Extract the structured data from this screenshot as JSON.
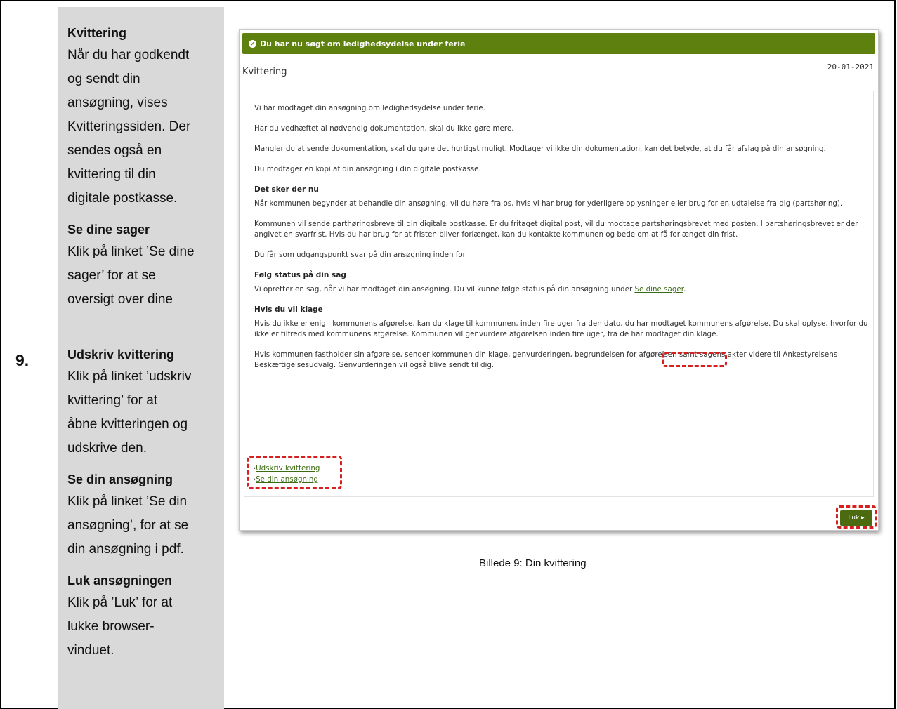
{
  "step": {
    "number": "9."
  },
  "sidebar": {
    "receipt": {
      "heading": "Kvittering",
      "text": "Når du har godkendt\nog sendt din\nansøgning, vises\nKvitteringssiden. Der\nsendes også en\nkvittering til din\ndigitale postkasse."
    },
    "cases": {
      "heading": "Se dine sager",
      "text": "Klik på linket ’Se dine\nsager’ for at se\noversigt over dine"
    },
    "print": {
      "heading": "Udskriv kvittering",
      "text": "Klik på linket ’udskriv\nkvittering’ for at\nåbne kvitteringen og\nudskrive den."
    },
    "application": {
      "heading": "Se din ansøgning",
      "text": "Klik på linket ’Se din\nansøgning’, for at se\ndin ansøgning i pdf."
    },
    "close": {
      "heading": "Luk ansøgningen",
      "text": "Klik på ’Luk’ for at\nlukke browser-\nvinduet."
    }
  },
  "screenshot": {
    "banner": "Du har nu søgt om ledighedsydelse under ferie",
    "title": "Kvittering",
    "date": "20-01-2021",
    "p1": "Vi har modtaget din ansøgning om ledighedsydelse under ferie.",
    "p2": "Har du vedhæftet al nødvendig dokumentation, skal du ikke gøre mere.",
    "p3": "Mangler du at sende dokumentation, skal du gøre det hurtigst muligt. Modtager vi ikke din dokumentation, kan det betyde, at du får afslag på din ansøgning.",
    "p4": "Du modtager en kopi af din ansøgning i din digitale postkasse.",
    "h1": "Det sker der nu",
    "p5": "Når kommunen begynder at behandle din ansøgning, vil du høre fra os, hvis vi har brug for yderligere oplysninger eller brug for en udtalelse fra dig (partshøring).",
    "p6": "Kommunen vil sende parthøringsbreve til din digitale postkasse. Er du fritaget digital post, vil du modtage partshøringsbrevet med posten. I partshøringsbrevet er der angivet en svarfrist. Hvis du har brug for at fristen bliver forlænget, kan du kontakte kommunen og bede om at få forlænget din frist.",
    "p7": "Du får som udgangspunkt svar på din ansøgning inden for",
    "h2": "Følg status på din sag",
    "p8": "Vi opretter en sag, når vi har modtaget din ansøgning. Du vil kunne følge status på din ansøgning under ",
    "cases_link": "Se dine sager",
    "h3": "Hvis du vil klage",
    "p9": "Hvis du ikke er enig i kommunens afgørelse, kan du klage til kommunen, inden fire uger fra den dato, du har modtaget kommunens afgørelse. Du skal oplyse, hvorfor du ikke er tilfreds med kommunens afgørelse. Kommunen vil genvurdere afgørelsen inden fire uger, fra de har modtaget din klage.",
    "p10": "Hvis kommunen fastholder sin afgørelse, sender kommunen din klage, genvurderingen, begrundelsen for afgørelsen samt sagens akter videre til Ankestyrelsens Beskæftigelsesudvalg. Genvurderingen vil også blive sendt til dig.",
    "print_link": "Udskriv kvittering",
    "application_link": "Se din ansøgning",
    "close_button": "Luk"
  },
  "caption": "Billede 9: Din kvittering",
  "colors": {
    "banner": "#5e800f",
    "highlight": "#d62020",
    "sidebar": "#d9d9d9"
  }
}
